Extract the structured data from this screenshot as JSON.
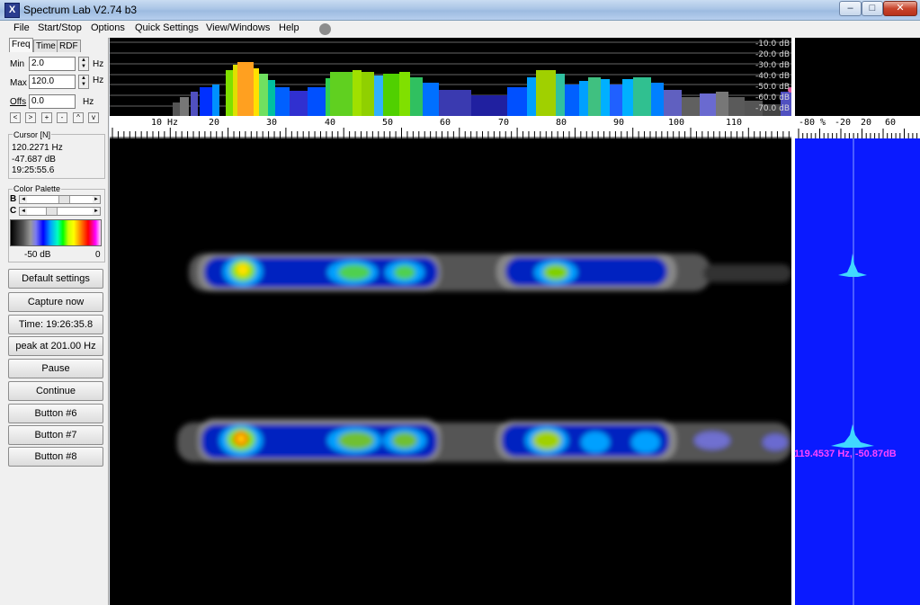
{
  "window": {
    "title": "Spectrum Lab V2.74 b3",
    "icon_label": "X"
  },
  "window_controls": {
    "minimize": "–",
    "maximize": "□",
    "close": "✕"
  },
  "menu": [
    "File",
    "Start/Stop",
    "Options",
    "Quick Settings",
    "View/Windows",
    "Help"
  ],
  "tabs": [
    "Freq",
    "Time",
    "RDF"
  ],
  "freq": {
    "min_label": "Min",
    "min_value": "2.0",
    "min_unit": "Hz",
    "max_label": "Max",
    "max_value": "120.0",
    "max_unit": "Hz",
    "offs_label": "Offs",
    "offs_value": "0.0",
    "offs_unit": "Hz"
  },
  "nav_buttons": [
    "<",
    ">",
    "+",
    "-",
    "^",
    "v"
  ],
  "cursor": {
    "title": "Cursor [N]",
    "freq": "120.2271 Hz",
    "level": "-47.687 dB",
    "time": "19:25:55.6"
  },
  "palette": {
    "title": "Color Palette",
    "b_label": "B",
    "c_label": "C",
    "min_label": "-50 dB",
    "max_label": "0"
  },
  "buttons": [
    "Default settings",
    "Capture now",
    "Time:  19:26:35.8",
    "peak at 201.00 Hz",
    "Pause",
    "Continue",
    "Button #6",
    "Button #7",
    "Button #8"
  ],
  "db_scale": [
    "-10.0 dB",
    "-20.0 dB",
    "-30.0 dB",
    "-40.0 dB",
    "-50.0 dB",
    "-60.0 dB",
    "-70.0 dB"
  ],
  "freq_axis": {
    "unit": "Hz",
    "labels": [
      "10",
      "20",
      "30",
      "40",
      "50",
      "60",
      "70",
      "80",
      "90",
      "100",
      "110"
    ]
  },
  "right_axis": {
    "labels": [
      "-80",
      "%",
      "-20",
      "20",
      "60"
    ]
  },
  "peak_readout": "119.4537 Hz, -50.87dB"
}
